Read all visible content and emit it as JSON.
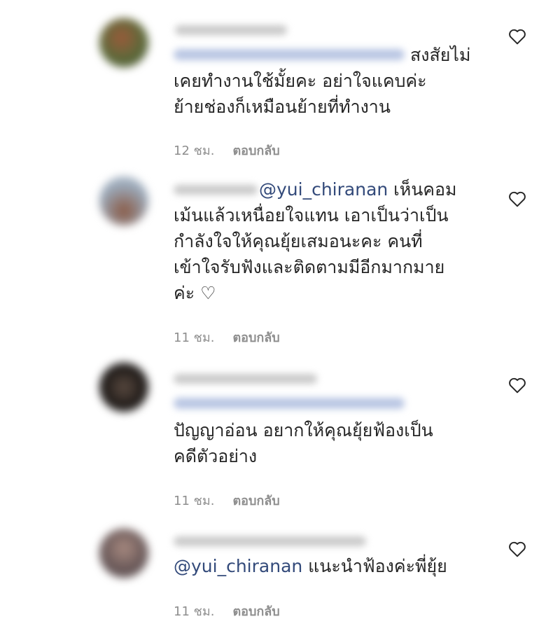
{
  "comments": [
    {
      "text": "สงสัยไม่\nเคยทำงานใช้มั้ยคะ อย่าใจแคบค่ะ\nย้ายช่องก็เหมือนย้ายที่ทำงาน",
      "time": "12 ชม.",
      "reply": "ตอบกลับ",
      "avatar_color": "#6a4a2e"
    },
    {
      "mention": "@yui_chiranan",
      "text": " เห็นคอม\nเม้นแล้วเหนื่อยใจแทน เอาเป็นว่าเป็น\nกำลังใจให้คุณยุ้ยเสมอนะคะ คนที่\nเข้าใจรับฟังและติดตามมีอีกมากมาย\nค่ะ ♡",
      "time": "11 ชม.",
      "reply": "ตอบกลับ",
      "avatar_color": "#8a6a55"
    },
    {
      "text": "ปัญญาอ่อน อยากให้คุณยุ้ยฟ้องเป็น\nคดีตัวอย่าง",
      "time": "11 ชม.",
      "reply": "ตอบกลับ",
      "avatar_color": "#2a2220"
    },
    {
      "mention": "@yui_chiranan",
      "text": " แนะนำฟ้องค่ะพี่ยุ้ย",
      "time": "11 ชม.",
      "reply": "ตอบกลับ",
      "avatar_color": "#6b5a5a"
    }
  ]
}
